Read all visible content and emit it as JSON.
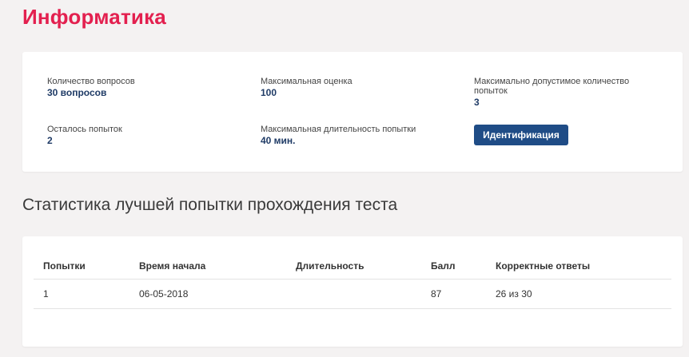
{
  "page": {
    "title": "Информатика"
  },
  "info": {
    "questions_label": "Количество вопросов",
    "questions_value": "30 вопросов",
    "max_score_label": "Максимальная оценка",
    "max_score_value": "100",
    "max_attempts_label": "Максимально допустимое количество попыток",
    "max_attempts_value": "3",
    "attempts_left_label": "Осталось попыток",
    "attempts_left_value": "2",
    "max_duration_label": "Максимальная длительность попытки",
    "max_duration_value": "40 мин.",
    "identify_button": "Идентификация"
  },
  "stats": {
    "title": "Статистика лучшей попытки прохождения теста",
    "columns": [
      "Попытки",
      "Время начала",
      "Длительность",
      "Балл",
      "Корректные ответы"
    ],
    "rows": [
      [
        "1",
        "06-05-2018",
        "",
        "87",
        "26 из 30"
      ]
    ]
  },
  "colors": {
    "accent": "#e3204f",
    "value_text": "#1f3b66",
    "button": "#1f4c86",
    "background": "#f4f2f2"
  }
}
